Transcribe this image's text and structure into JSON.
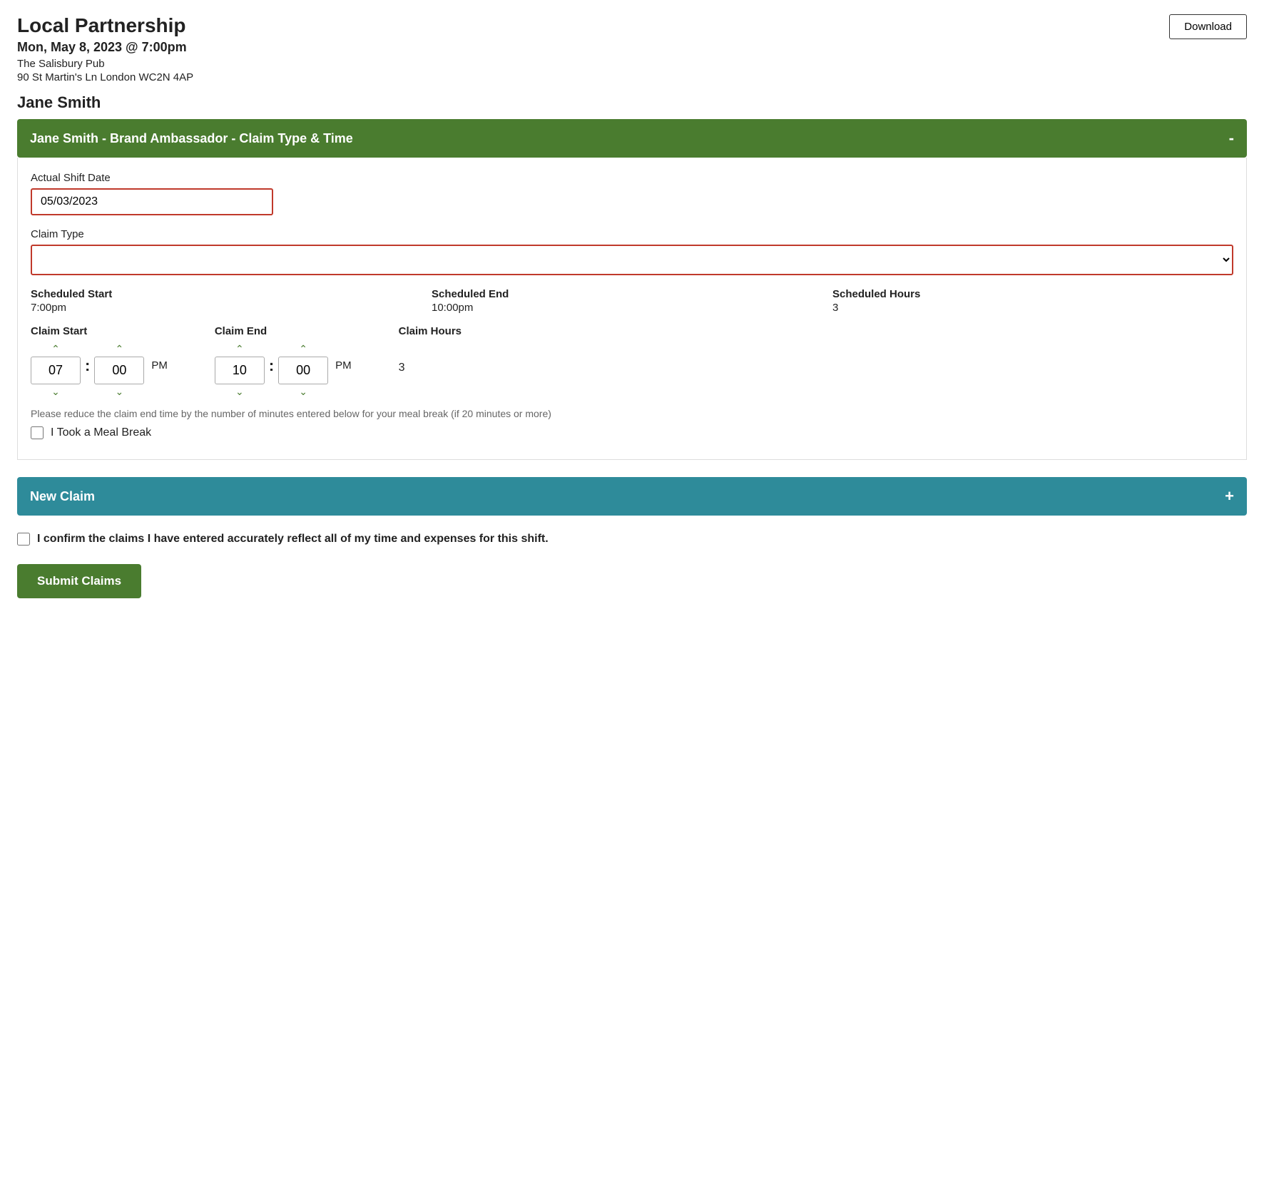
{
  "header": {
    "title": "Local Partnership",
    "event_date": "Mon, May 8, 2023 @ 7:00pm",
    "venue_name": "The Salisbury Pub",
    "venue_address": "90 St Martin's Ln London WC2N 4AP",
    "download_label": "Download"
  },
  "person": {
    "name": "Jane Smith"
  },
  "claim_section": {
    "header_label": "Jane Smith - Brand Ambassador - Claim Type & Time",
    "toggle_icon": "-",
    "actual_shift_date_label": "Actual Shift Date",
    "actual_shift_date_value": "05/03/2023",
    "claim_type_label": "Claim Type",
    "claim_type_placeholder": "",
    "scheduled": {
      "start_label": "Scheduled Start",
      "start_value": "7:00pm",
      "end_label": "Scheduled End",
      "end_value": "10:00pm",
      "hours_label": "Scheduled Hours",
      "hours_value": "3"
    },
    "claim_start_label": "Claim Start",
    "claim_end_label": "Claim End",
    "claim_hours_label": "Claim Hours",
    "claim_hours_value": "3",
    "claim_start_hour": "07",
    "claim_start_min": "00",
    "claim_start_ampm": "PM",
    "claim_end_hour": "10",
    "claim_end_min": "00",
    "claim_end_ampm": "PM",
    "meal_break_note": "Please reduce the claim end time by the number of minutes entered below for your meal break (if 20 minutes or more)",
    "meal_break_label": "I Took a Meal Break"
  },
  "new_claim_section": {
    "header_label": "New Claim",
    "toggle_icon": "+"
  },
  "confirm": {
    "label": "I confirm the claims I have entered accurately reflect all of my time and expenses for this shift."
  },
  "submit": {
    "label": "Submit Claims"
  }
}
